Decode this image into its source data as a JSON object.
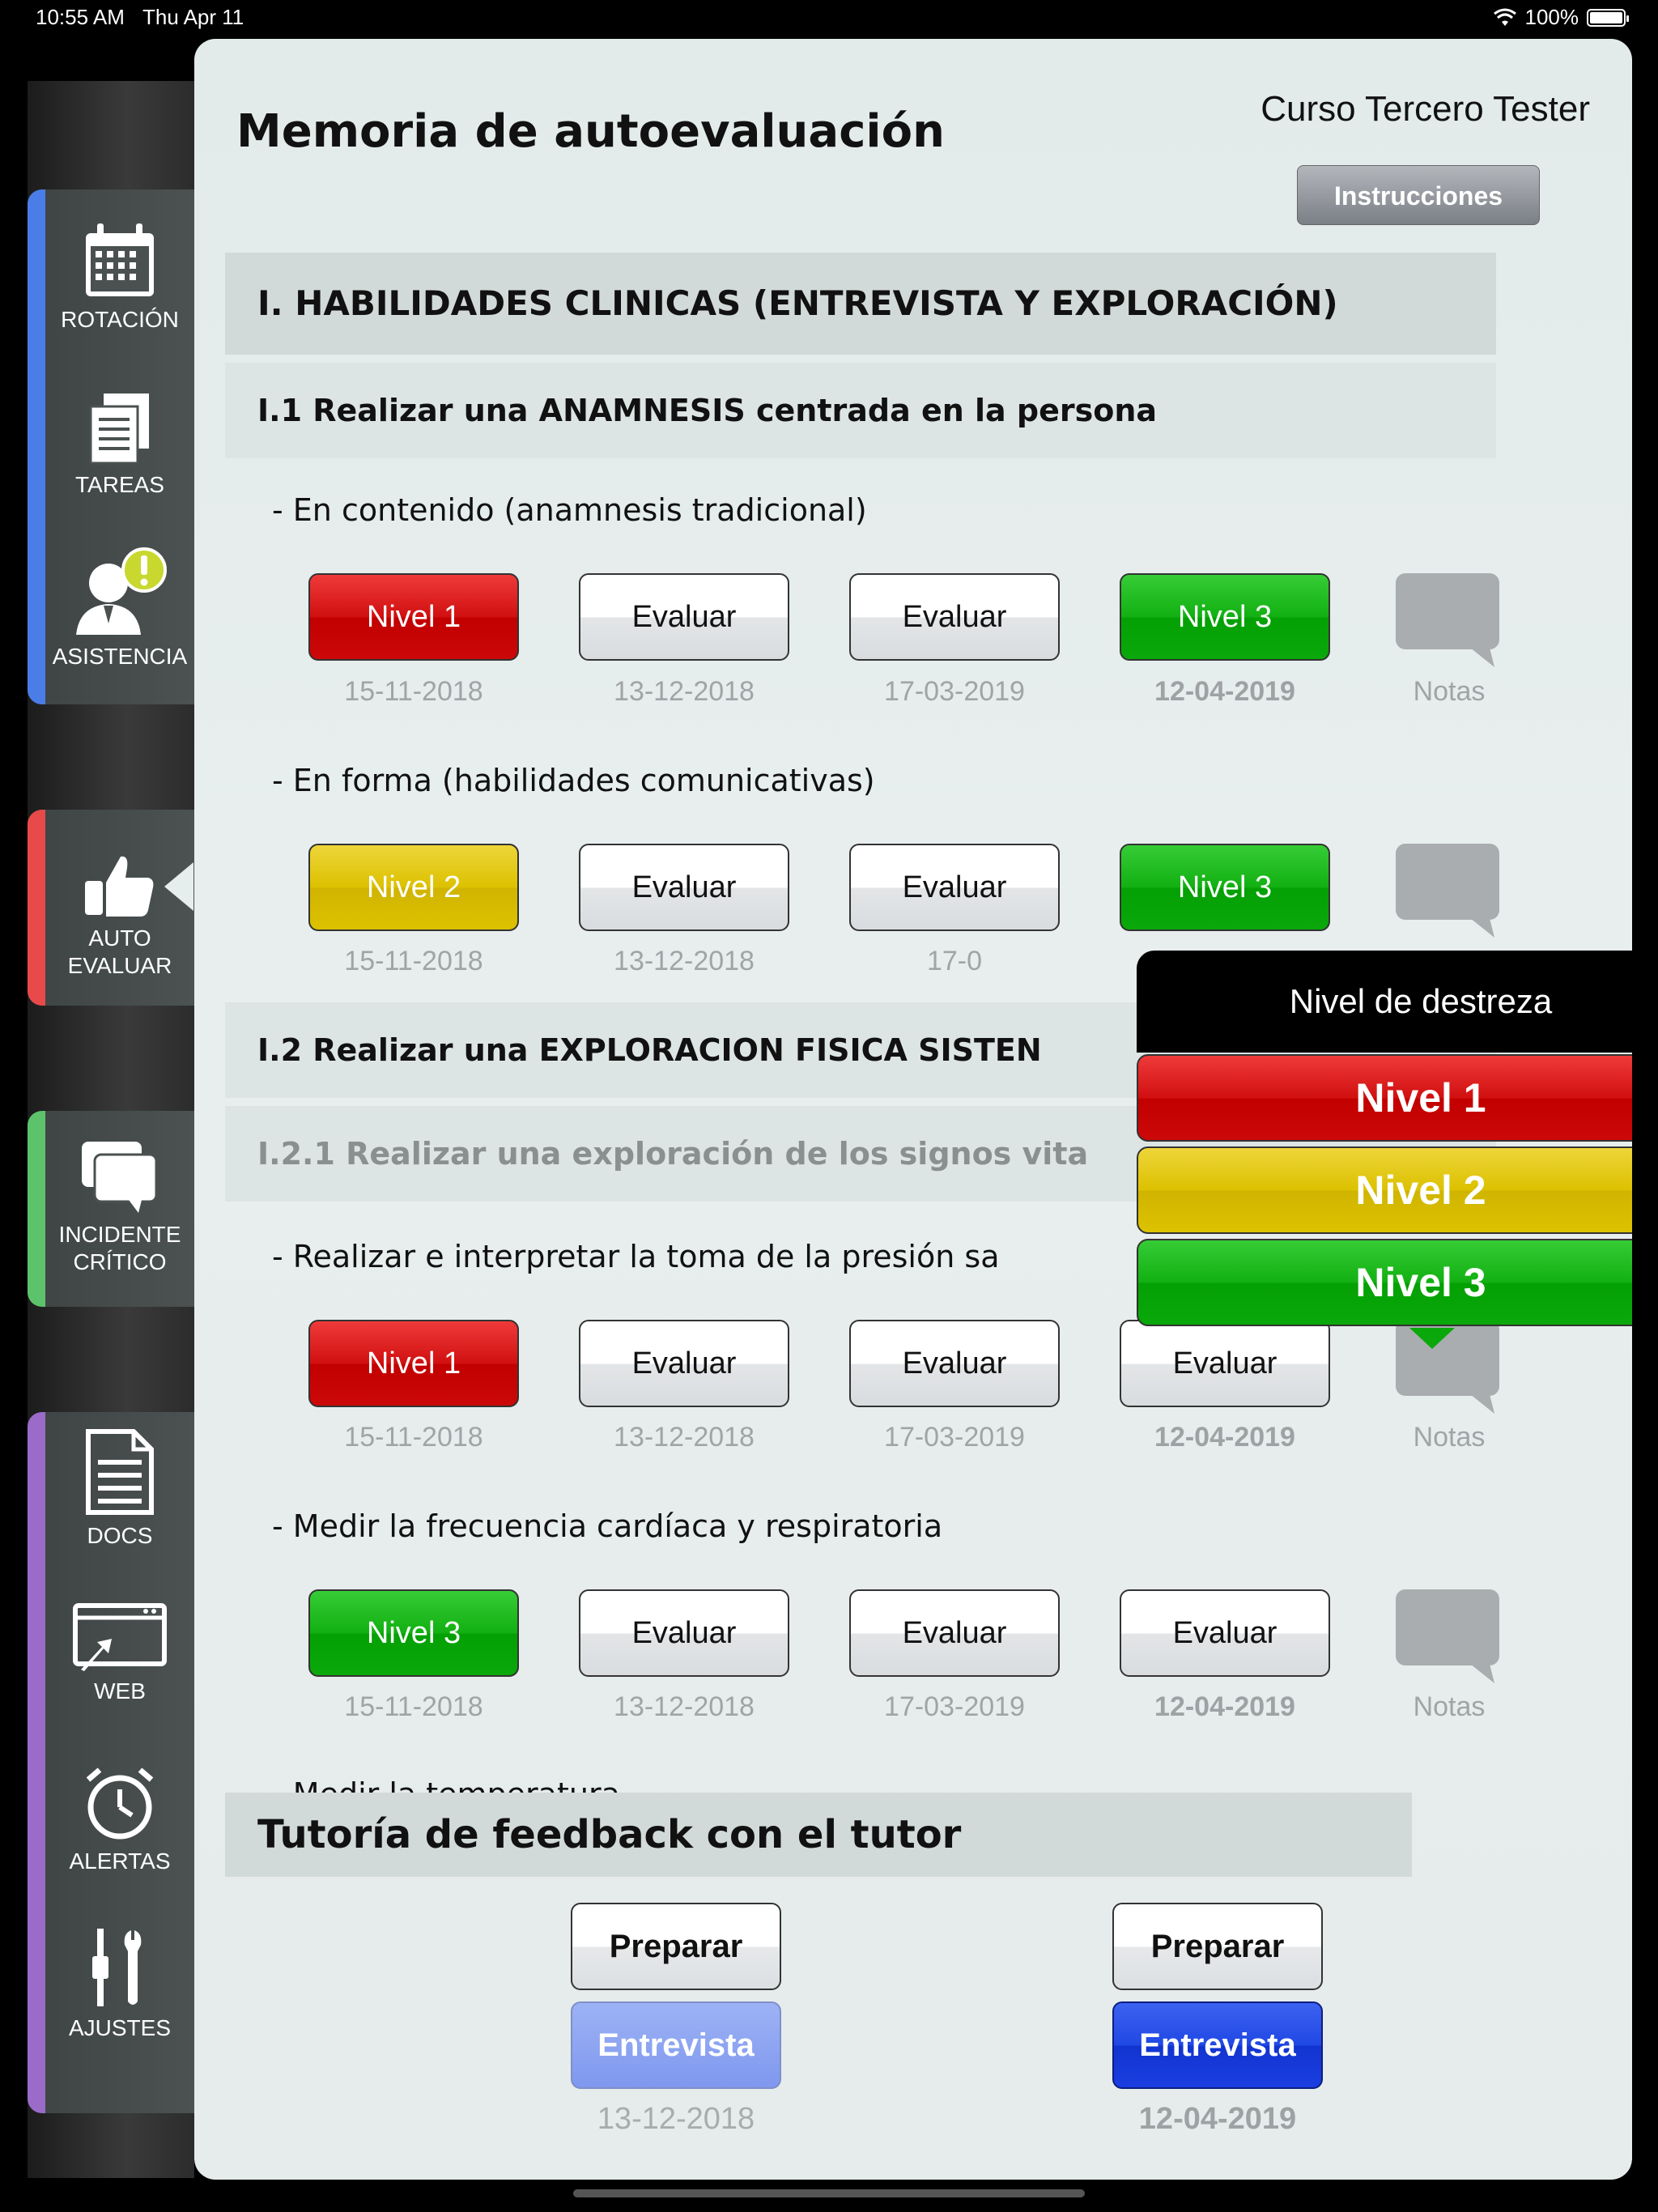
{
  "status_bar": {
    "time": "10:55 AM",
    "date": "Thu Apr 11",
    "battery": "100%"
  },
  "sidebar": {
    "items": [
      {
        "label": "ROTACIÓN",
        "icon": "calendar-icon"
      },
      {
        "label": "TAREAS",
        "icon": "documents-icon"
      },
      {
        "label": "ASISTENCIA",
        "icon": "user-alert-icon"
      },
      {
        "label": "AUTO\nEVALUAR",
        "icon": "thumbs-up-icon"
      },
      {
        "label": "INCIDENTE\nCRÍTICO",
        "icon": "chat-bubbles-icon"
      },
      {
        "label": "DOCS",
        "icon": "document-icon"
      },
      {
        "label": "WEB",
        "icon": "web-window-icon"
      },
      {
        "label": "ALERTAS",
        "icon": "alarm-clock-icon"
      },
      {
        "label": "AJUSTES",
        "icon": "tools-icon"
      }
    ],
    "colors": {
      "blue": "#4a7de8",
      "red": "#e84a4a",
      "green": "#5dc36b",
      "purple": "#9b6bc9"
    }
  },
  "header": {
    "title": "Memoria de autoevaluación",
    "course": "Curso Tercero Tester",
    "instructions_label": "Instrucciones"
  },
  "section": {
    "title": "I. HABILIDADES CLINICAS (ENTREVISTA Y EXPLORACIÓN)",
    "sub1": "I.1 Realizar una ANAMNESIS centrada en la persona",
    "sub2": "I.2 Realizar una EXPLORACION FISICA SISTEN",
    "sub2_1": "I.2.1 Realizar una exploración de los signos vita"
  },
  "rows": [
    {
      "label": "- En contenido (anamnesis tradicional)",
      "buttons": [
        {
          "label": "Nivel 1",
          "level": 1
        },
        {
          "label": "Evaluar",
          "level": 0
        },
        {
          "label": "Evaluar",
          "level": 0
        },
        {
          "label": "Nivel 3",
          "level": 3
        }
      ],
      "dates": [
        "15-11-2018",
        "13-12-2018",
        "17-03-2019",
        "12-04-2019"
      ]
    },
    {
      "label": "- En forma (habilidades comunicativas)",
      "buttons": [
        {
          "label": "Nivel 2",
          "level": 2
        },
        {
          "label": "Evaluar",
          "level": 0
        },
        {
          "label": "Evaluar",
          "level": 0
        },
        {
          "label": "Nivel 3",
          "level": 3
        }
      ],
      "dates": [
        "15-11-2018",
        "13-12-2018",
        "17-0"
      ]
    },
    {
      "label": "- Realizar e interpretar la toma de la presión sa",
      "buttons": [
        {
          "label": "Nivel 1",
          "level": 1
        },
        {
          "label": "Evaluar",
          "level": 0
        },
        {
          "label": "Evaluar",
          "level": 0
        },
        {
          "label": "Evaluar",
          "level": 0
        }
      ],
      "dates": [
        "15-11-2018",
        "13-12-2018",
        "17-03-2019",
        "12-04-2019"
      ]
    },
    {
      "label": "- Medir la frecuencia cardíaca y respiratoria",
      "buttons": [
        {
          "label": "Nivel 3",
          "level": 3
        },
        {
          "label": "Evaluar",
          "level": 0
        },
        {
          "label": "Evaluar",
          "level": 0
        },
        {
          "label": "Evaluar",
          "level": 0
        }
      ],
      "dates": [
        "15-11-2018",
        "13-12-2018",
        "17-03-2019",
        "12-04-2019"
      ]
    }
  ],
  "partial_row_label": "- Medir la temperatura",
  "notes_label": "Notas",
  "popover": {
    "title": "Nivel de destreza",
    "options": [
      "Nivel 1",
      "Nivel 2",
      "Nivel 3"
    ]
  },
  "feedback": {
    "title": "Tutoría de feedback con el tutor",
    "sessions": [
      {
        "prepare_label": "Preparar",
        "interview_label": "Entrevista",
        "date": "13-12-2018",
        "active": false
      },
      {
        "prepare_label": "Preparar",
        "interview_label": "Entrevista",
        "date": "12-04-2019",
        "active": true
      }
    ]
  },
  "colors": {
    "nivel1": "#c80000",
    "nivel2": "#d6bc00",
    "nivel3": "#08a808",
    "interview_active": "#1a44e0",
    "interview_inactive": "#8aa2f0"
  }
}
